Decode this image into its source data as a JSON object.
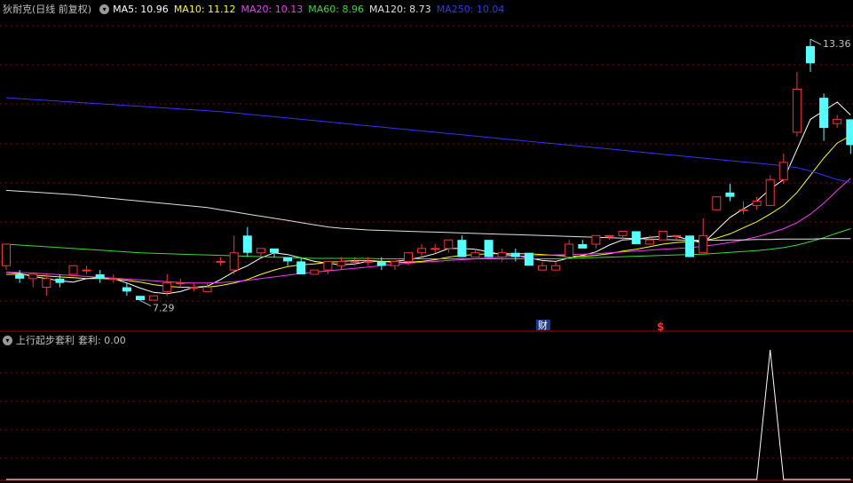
{
  "stock": {
    "name": "狄耐克(日线 前复权)"
  },
  "ma": [
    {
      "label": "MA5: 10.96",
      "color": "#ffffff"
    },
    {
      "label": "MA10: 11.12",
      "color": "#ffff00"
    },
    {
      "label": "MA20: 10.13",
      "color": "#ff33ff"
    },
    {
      "label": "MA60: 8.96",
      "color": "#33dd33"
    },
    {
      "label": "MA120: 8.73",
      "color": "#e0e0e0"
    },
    {
      "label": "MA250: 10.04",
      "color": "#3333ff"
    }
  ],
  "price_marks": {
    "high": "13.36",
    "low": "7.29"
  },
  "event_marks": {
    "fin": "财",
    "dollar": "$"
  },
  "indicator": {
    "name": "上行起步套利",
    "value_label": "套利: 0.00"
  },
  "colors": {
    "up": "#ff3030",
    "down": "#54ffff",
    "grid": "#8b0000",
    "axis": "#b00000"
  },
  "chart_data": {
    "type": "candlestick",
    "ylim": [
      6.6,
      13.9
    ],
    "candles": [
      [
        8.1,
        8.6,
        8.0,
        8.1
      ],
      [
        7.9,
        7.8,
        7.7,
        8.0
      ],
      [
        7.8,
        7.9,
        7.6,
        7.9
      ],
      [
        7.6,
        7.8,
        7.4,
        7.9
      ],
      [
        7.8,
        7.7,
        7.6,
        7.9
      ],
      [
        7.9,
        8.1,
        7.9,
        8.1
      ],
      [
        8.0,
        8.0,
        7.9,
        8.1
      ],
      [
        7.9,
        7.8,
        7.7,
        8.0
      ],
      [
        7.8,
        7.8,
        7.7,
        7.9
      ],
      [
        7.6,
        7.5,
        7.4,
        7.7
      ],
      [
        7.4,
        7.3,
        7.29,
        7.4
      ],
      [
        7.3,
        7.4,
        7.3,
        7.4
      ],
      [
        7.5,
        7.7,
        7.4,
        7.9
      ],
      [
        7.7,
        7.7,
        7.6,
        7.8
      ],
      [
        7.6,
        7.6,
        7.5,
        7.7
      ],
      [
        7.5,
        7.6,
        7.5,
        7.7
      ],
      [
        8.2,
        8.2,
        8.1,
        8.3
      ],
      [
        8.0,
        8.4,
        7.9,
        8.8
      ],
      [
        8.8,
        8.4,
        8.3,
        9.0
      ],
      [
        8.4,
        8.5,
        8.3,
        8.5
      ],
      [
        8.5,
        8.4,
        8.3,
        8.5
      ],
      [
        8.3,
        8.2,
        8.1,
        8.3
      ],
      [
        8.2,
        7.9,
        7.9,
        8.3
      ],
      [
        7.9,
        8.0,
        7.9,
        8.0
      ],
      [
        8.0,
        8.2,
        7.9,
        8.2
      ],
      [
        8.1,
        8.2,
        8.0,
        8.3
      ],
      [
        8.2,
        8.2,
        8.1,
        8.3
      ],
      [
        8.2,
        8.2,
        8.1,
        8.3
      ],
      [
        8.2,
        8.1,
        8.0,
        8.3
      ],
      [
        8.1,
        8.2,
        8.0,
        8.2
      ],
      [
        8.2,
        8.4,
        8.1,
        8.4
      ],
      [
        8.4,
        8.5,
        8.3,
        8.6
      ],
      [
        8.5,
        8.5,
        8.4,
        8.6
      ],
      [
        8.5,
        8.7,
        8.4,
        8.7
      ],
      [
        8.7,
        8.3,
        8.3,
        8.8
      ],
      [
        8.3,
        8.4,
        8.3,
        8.5
      ],
      [
        8.7,
        8.3,
        8.3,
        8.7
      ],
      [
        8.3,
        8.4,
        8.2,
        8.5
      ],
      [
        8.4,
        8.3,
        8.2,
        8.5
      ],
      [
        8.4,
        8.1,
        8.1,
        8.4
      ],
      [
        8.0,
        8.1,
        8.0,
        8.2
      ],
      [
        8.0,
        8.1,
        8.0,
        8.2
      ],
      [
        8.3,
        8.6,
        8.3,
        8.7
      ],
      [
        8.6,
        8.5,
        8.5,
        8.7
      ],
      [
        8.6,
        8.8,
        8.5,
        8.8
      ],
      [
        8.8,
        8.8,
        8.7,
        8.8
      ],
      [
        8.8,
        8.9,
        8.7,
        8.9
      ],
      [
        8.9,
        8.6,
        8.6,
        8.9
      ],
      [
        8.6,
        8.7,
        8.6,
        8.8
      ],
      [
        8.7,
        8.9,
        8.7,
        8.9
      ],
      [
        8.8,
        8.8,
        8.7,
        8.8
      ],
      [
        8.8,
        8.3,
        8.3,
        8.8
      ],
      [
        8.4,
        8.8,
        8.4,
        9.2
      ],
      [
        9.4,
        9.7,
        9.4,
        9.7
      ],
      [
        9.8,
        9.7,
        9.6,
        10.0
      ],
      [
        9.4,
        9.4,
        9.3,
        9.6
      ],
      [
        9.5,
        9.6,
        9.4,
        9.7
      ],
      [
        9.5,
        10.1,
        9.5,
        10.2
      ],
      [
        10.1,
        10.5,
        10.0,
        10.7
      ],
      [
        11.2,
        12.2,
        11.1,
        12.6
      ],
      [
        13.2,
        12.8,
        12.6,
        13.36
      ],
      [
        12.0,
        11.3,
        11.0,
        12.1
      ],
      [
        11.4,
        11.5,
        11.3,
        11.6
      ],
      [
        11.5,
        10.9,
        10.7,
        11.5
      ]
    ],
    "ma5": [
      7.95,
      7.92,
      7.85,
      7.8,
      7.75,
      7.72,
      7.8,
      7.83,
      7.8,
      7.7,
      7.58,
      7.48,
      7.45,
      7.5,
      7.6,
      7.62,
      7.78,
      7.96,
      8.1,
      8.28,
      8.4,
      8.36,
      8.28,
      8.2,
      8.16,
      8.12,
      8.14,
      8.2,
      8.2,
      8.2,
      8.24,
      8.3,
      8.38,
      8.5,
      8.5,
      8.48,
      8.42,
      8.36,
      8.34,
      8.28,
      8.22,
      8.2,
      8.28,
      8.34,
      8.42,
      8.58,
      8.7,
      8.72,
      8.76,
      8.78,
      8.78,
      8.7,
      8.62,
      8.92,
      9.22,
      9.42,
      9.6,
      9.88,
      10.1,
      10.8,
      11.5,
      11.7,
      11.9,
      11.6
    ],
    "ma10": [
      7.9,
      7.9,
      7.88,
      7.86,
      7.84,
      7.82,
      7.8,
      7.8,
      7.79,
      7.76,
      7.72,
      7.66,
      7.62,
      7.6,
      7.6,
      7.6,
      7.64,
      7.7,
      7.78,
      7.9,
      8.0,
      8.08,
      8.12,
      8.14,
      8.18,
      8.2,
      8.22,
      8.22,
      8.2,
      8.18,
      8.18,
      8.2,
      8.24,
      8.3,
      8.34,
      8.36,
      8.38,
      8.38,
      8.38,
      8.38,
      8.36,
      8.34,
      8.32,
      8.32,
      8.34,
      8.38,
      8.44,
      8.48,
      8.54,
      8.6,
      8.64,
      8.66,
      8.68,
      8.74,
      8.84,
      8.98,
      9.12,
      9.3,
      9.5,
      9.8,
      10.2,
      10.6,
      10.95,
      11.12
    ],
    "ma20": [
      7.95,
      7.94,
      7.93,
      7.91,
      7.89,
      7.87,
      7.85,
      7.83,
      7.81,
      7.79,
      7.77,
      7.75,
      7.73,
      7.71,
      7.7,
      7.7,
      7.71,
      7.73,
      7.76,
      7.8,
      7.84,
      7.88,
      7.92,
      7.95,
      7.98,
      8.01,
      8.04,
      8.07,
      8.1,
      8.13,
      8.16,
      8.18,
      8.2,
      8.22,
      8.24,
      8.26,
      8.28,
      8.3,
      8.32,
      8.33,
      8.34,
      8.35,
      8.36,
      8.37,
      8.38,
      8.4,
      8.42,
      8.44,
      8.46,
      8.48,
      8.5,
      8.52,
      8.55,
      8.59,
      8.64,
      8.7,
      8.77,
      8.86,
      8.96,
      9.1,
      9.3,
      9.55,
      9.85,
      10.13
    ],
    "ma60": [
      8.6,
      8.58,
      8.56,
      8.54,
      8.52,
      8.5,
      8.48,
      8.46,
      8.44,
      8.42,
      8.4,
      8.39,
      8.38,
      8.37,
      8.36,
      8.35,
      8.34,
      8.33,
      8.32,
      8.31,
      8.3,
      8.29,
      8.28,
      8.27,
      8.27,
      8.27,
      8.27,
      8.27,
      8.26,
      8.26,
      8.26,
      8.26,
      8.26,
      8.26,
      8.26,
      8.26,
      8.26,
      8.26,
      8.26,
      8.26,
      8.26,
      8.26,
      8.27,
      8.28,
      8.29,
      8.3,
      8.31,
      8.32,
      8.33,
      8.34,
      8.35,
      8.36,
      8.37,
      8.39,
      8.41,
      8.43,
      8.45,
      8.48,
      8.52,
      8.58,
      8.66,
      8.75,
      8.86,
      8.96
    ],
    "ma120": [
      9.85,
      9.83,
      9.81,
      9.79,
      9.77,
      9.75,
      9.72,
      9.69,
      9.66,
      9.63,
      9.6,
      9.57,
      9.54,
      9.51,
      9.48,
      9.45,
      9.4,
      9.35,
      9.3,
      9.25,
      9.2,
      9.15,
      9.1,
      9.05,
      9.0,
      8.97,
      8.95,
      8.93,
      8.92,
      8.91,
      8.9,
      8.89,
      8.88,
      8.87,
      8.86,
      8.85,
      8.84,
      8.83,
      8.82,
      8.81,
      8.8,
      8.79,
      8.78,
      8.77,
      8.76,
      8.75,
      8.74,
      8.73,
      8.72,
      8.71,
      8.7,
      8.69,
      8.69,
      8.69,
      8.7,
      8.7,
      8.71,
      8.71,
      8.72,
      8.72,
      8.72,
      8.73,
      8.73,
      8.73
    ],
    "ma250": [
      12.0,
      11.98,
      11.96,
      11.94,
      11.92,
      11.9,
      11.88,
      11.86,
      11.84,
      11.82,
      11.8,
      11.78,
      11.76,
      11.74,
      11.72,
      11.7,
      11.68,
      11.65,
      11.62,
      11.59,
      11.56,
      11.53,
      11.5,
      11.47,
      11.44,
      11.41,
      11.38,
      11.35,
      11.32,
      11.29,
      11.26,
      11.23,
      11.2,
      11.17,
      11.14,
      11.11,
      11.08,
      11.05,
      11.02,
      10.99,
      10.96,
      10.93,
      10.9,
      10.87,
      10.84,
      10.81,
      10.78,
      10.75,
      10.72,
      10.69,
      10.66,
      10.63,
      10.6,
      10.57,
      10.54,
      10.51,
      10.48,
      10.45,
      10.42,
      10.38,
      10.3,
      10.2,
      10.1,
      10.04
    ],
    "signal": {
      "ylim": [
        0,
        1
      ],
      "values": [
        0,
        0,
        0,
        0,
        0,
        0,
        0,
        0,
        0,
        0,
        0,
        0,
        0,
        0,
        0,
        0,
        0,
        0,
        0,
        0,
        0,
        0,
        0,
        0,
        0,
        0,
        0,
        0,
        0,
        0,
        0,
        0,
        0,
        0,
        0,
        0,
        0,
        0,
        0,
        0,
        0,
        0,
        0,
        0,
        0,
        0,
        0,
        0,
        0,
        0,
        0,
        0,
        0,
        0,
        0,
        0,
        0,
        1,
        0,
        0,
        0,
        0,
        0,
        0
      ]
    }
  }
}
